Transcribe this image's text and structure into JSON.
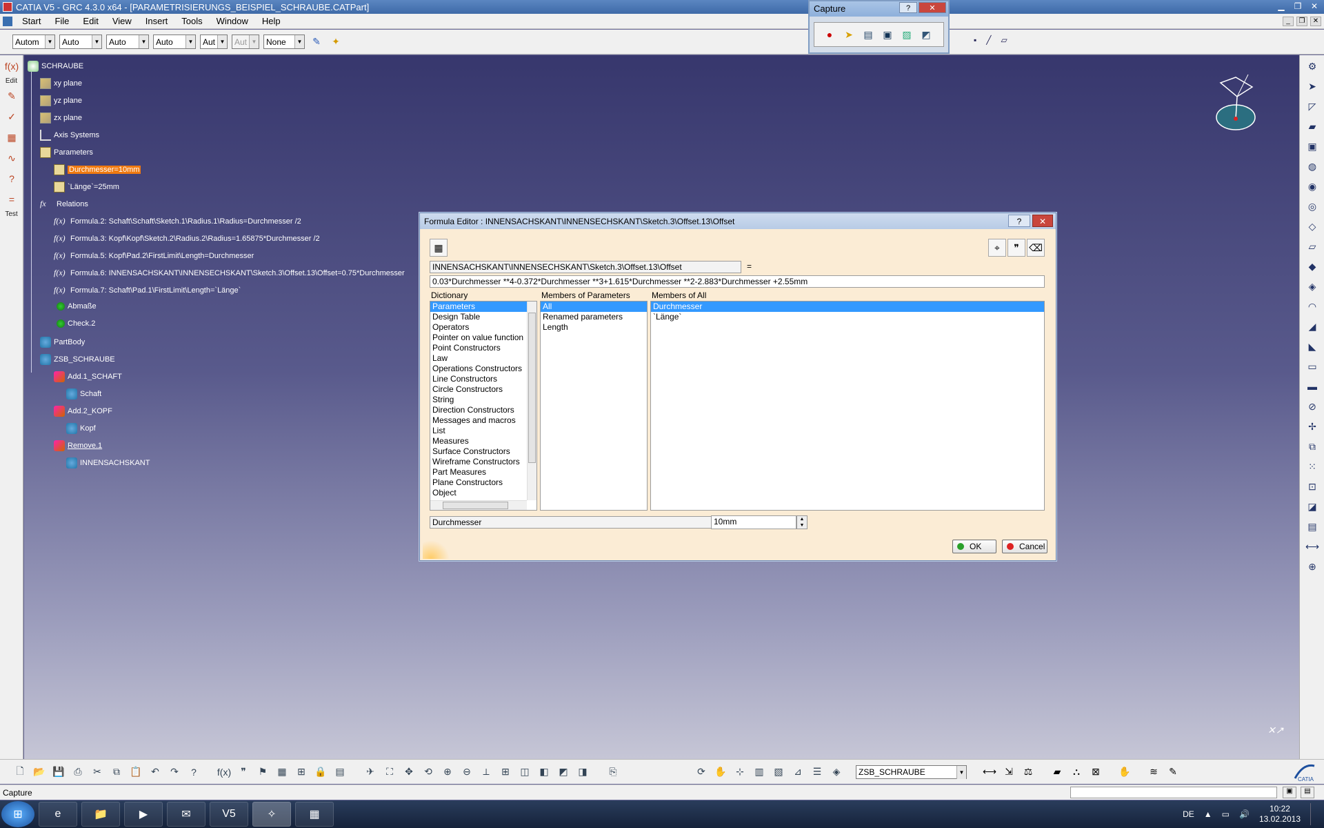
{
  "window": {
    "title": "CATIA V5 - GRC 4.3.0 x64 - [PARAMETRISIERUNGS_BEISPIEL_SCHRAUBE.CATPart]"
  },
  "menu": [
    "Start",
    "File",
    "Edit",
    "View",
    "Insert",
    "Tools",
    "Window",
    "Help"
  ],
  "top_toolbar": {
    "combos": [
      "Autom",
      "Auto",
      "Auto",
      "Auto",
      "Aut",
      "Aut",
      "None"
    ]
  },
  "capture_toolbar": {
    "title": "Capture"
  },
  "left_toolbar": {
    "labels": [
      "Edit",
      "Test"
    ]
  },
  "tree": {
    "root": "SCHRAUBE",
    "xy_plane": "xy plane",
    "yz_plane": "yz plane",
    "zx_plane": "zx plane",
    "axis_systems": "Axis Systems",
    "parameters": "Parameters",
    "param_durchmesser": "Durchmesser=10mm",
    "param_laenge": "`Länge`=25mm",
    "relations": "Relations",
    "formulas": [
      "Formula.2: Schaft\\Schaft\\Sketch.1\\Radius.1\\Radius=Durchmesser /2",
      "Formula.3: Kopf\\Kopf\\Sketch.2\\Radius.2\\Radius=1.65875*Durchmesser /2",
      "Formula.5: Kopf\\Pad.2\\FirstLimit\\Length=Durchmesser",
      "Formula.6: INNENSACHSKANT\\INNENSECHSKANT\\Sketch.3\\Offset.13\\Offset=0.75*Durchmesser",
      "Formula.7: Schaft\\Pad.1\\FirstLimit\\Length=`Länge`"
    ],
    "abmasse": "Abmaße",
    "check": "Check.2",
    "partbody": "PartBody",
    "zsb": "ZSB_SCHRAUBE",
    "add1": "Add.1_SCHAFT",
    "schaft": "Schaft",
    "add2": "Add.2_KOPF",
    "kopf": "Kopf",
    "remove": "Remove.1",
    "innen": "INNENSACHSKANT"
  },
  "dialog": {
    "title": "Formula Editor : INNENSACHSKANT\\INNENSECHSKANT\\Sketch.3\\Offset.13\\Offset",
    "param_path": "INNENSACHSKANT\\INNENSECHSKANT\\Sketch.3\\Offset.13\\Offset",
    "equals": "=",
    "formula": "0.03*Durchmesser **4-0.372*Durchmesser **3+1.615*Durchmesser **2-2.883*Durchmesser +2.55mm",
    "dictionary_label": "Dictionary",
    "members_params_label": "Members of Parameters",
    "members_all_label": "Members of All",
    "dictionary": [
      "Parameters",
      "Design Table",
      "Operators",
      "Pointer on value function",
      "Point Constructors",
      "Law",
      "Operations Constructors",
      "Line Constructors",
      "Circle Constructors",
      "String",
      "Direction Constructors",
      "Messages and macros",
      "List",
      "Measures",
      "Surface Constructors",
      "Wireframe Constructors",
      "Part Measures",
      "Plane Constructors",
      "Object"
    ],
    "members_params": [
      "All",
      "Renamed parameters",
      "Length"
    ],
    "members_all": [
      "Durchmesser",
      "`Länge`"
    ],
    "selected_name": "Durchmesser",
    "selected_value": "10mm",
    "ok_label": "OK",
    "cancel_label": "Cancel",
    "help_btn": "?",
    "close_btn": "✕"
  },
  "bottom_toolbar": {
    "current_body": "ZSB_SCHRAUBE"
  },
  "status": {
    "text": "Capture"
  },
  "taskbar": {
    "lang": "DE",
    "time": "10:22",
    "date": "13.02.2013"
  },
  "colors": {
    "tree_highlight": "#f07a10",
    "selection": "#3399ff",
    "dialog_bg": "#fbecd5"
  }
}
